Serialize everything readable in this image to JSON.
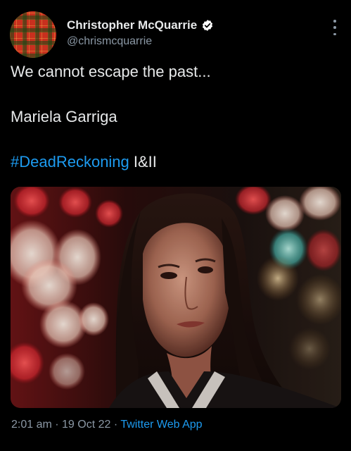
{
  "author": {
    "display_name": "Christopher McQuarrie",
    "handle": "@chrismcquarrie",
    "verified": true
  },
  "tweet": {
    "lines": [
      "We cannot escape the past...",
      "Mariela Garriga"
    ],
    "hashtag": "#DeadReckoning",
    "hashtag_suffix": " I&II"
  },
  "meta": {
    "time": "2:01 am",
    "separator": " · ",
    "date": "19 Oct 22",
    "source": "Twitter Web App"
  },
  "icons": {
    "verified": "verified-badge-icon",
    "more": "more-options-icon"
  },
  "colors": {
    "background": "#000000",
    "text": "#e7e9ea",
    "secondary": "#8b98a5",
    "link": "#1d9bf0"
  }
}
